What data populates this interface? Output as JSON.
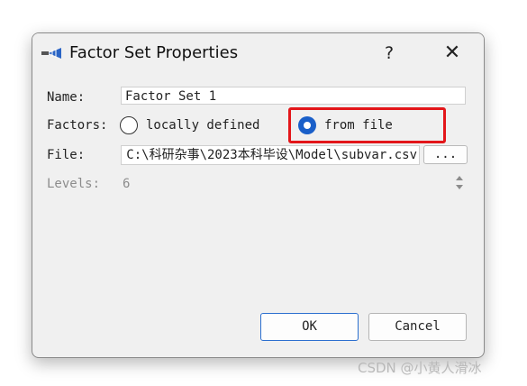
{
  "window": {
    "title": "Factor Set Properties",
    "help_label": "?",
    "close_label": "✕",
    "icon": "factor-set-app-icon"
  },
  "form": {
    "name_label": "Name:",
    "name_value": "Factor Set 1",
    "factors_label": "Factors:",
    "option_local": "locally defined",
    "option_file": "from file",
    "selected_option": "from file",
    "file_label": "File:",
    "file_value": "C:\\科研杂事\\2023本科毕设\\Model\\subvar.csv",
    "browse_label": "...",
    "levels_label": "Levels:",
    "levels_value": "6"
  },
  "buttons": {
    "ok": "OK",
    "cancel": "Cancel"
  },
  "colors": {
    "accent": "#1a5fc9",
    "highlight": "#e3161a",
    "dialog_bg": "#f0f0f0"
  },
  "watermark": "CSDN @小黄人滑冰"
}
